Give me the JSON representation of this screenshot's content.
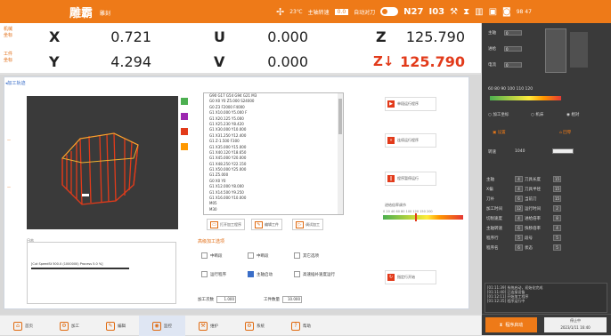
{
  "app": {
    "logo": "雕霸",
    "subtitle": "雕刻"
  },
  "topbar": {
    "temp": "23℃",
    "rpm_label": "主轴转速",
    "rpm_value": "0.0",
    "lock_label": "自动对刀",
    "counter1": "N27",
    "counter2": "I03",
    "status": "98 47"
  },
  "axes": {
    "mode_top": "机械\n坐标",
    "mode_bot": "工件\n坐标",
    "x": {
      "label": "X",
      "value": "0.721"
    },
    "y": {
      "label": "Y",
      "value": "4.294"
    },
    "u": {
      "label": "U",
      "value": "0.000"
    },
    "v": {
      "label": "V",
      "value": "0.000"
    },
    "z": {
      "label": "Z",
      "value": "125.790"
    },
    "z2": {
      "label": "Z",
      "value": "125.790"
    }
  },
  "main": {
    "tab": "◂加工轨迹",
    "program_lines": [
      "G90 G17 G54 G94 G21 M3",
      "G0 X0 Y0 Z5.000 S24000",
      "G0 Z3 F2000 F4000",
      "G1 X10.000 Y5.000 F",
      "G1 X20.125 Y5.000",
      "G1 X25.230 Y8.420",
      "G1 X30.000 Y10.000",
      "G1 X31.250 Y12.400",
      "G1 Z-1.500 F300",
      "G1 X35.000 Y15.000",
      "G1 X40.120 Y18.650",
      "G1 X45.000 Y20.000",
      "G1 X48.250 Y22.150",
      "G1 X50.000 Y25.000",
      "G1 Z5.000",
      "G0 X0 Y0",
      "G1 X12.000 Y8.000",
      "G1 X14.500 Y9.250",
      "G1 X16.000 Y10.000",
      "M05",
      "M30"
    ],
    "right_buttons": [
      "单段运行程序",
      "连续运行程序",
      "程序暂停运行"
    ],
    "bottom_buttons": [
      "打开加工程序",
      "编辑工件",
      "调试加工"
    ],
    "ratio_label": "进给倍率调节",
    "ratio_ticks": "0 20 40 60 80 100 120 150 200",
    "options_title": "高级加工选项",
    "opts_row1": [
      "中断段",
      "中断段",
      "其它选项"
    ],
    "opts_row2": [
      "运行程序",
      "主轴启动",
      "高速插补速度运行"
    ],
    "opt2_checked": true,
    "field1_label": "加工次数",
    "field1_value": "1.000",
    "field2_label": "工件数量",
    "field2_value": "10.000",
    "restart_btn": "指定行开始",
    "log_title": "日志",
    "log_line": "[Cut SpeedSt 500.0 (1000000) Process 5.0 %]"
  },
  "bottom_nav": [
    {
      "icon": "home-icon",
      "label": "首页"
    },
    {
      "icon": "process-icon",
      "label": "加工"
    },
    {
      "icon": "edit-icon",
      "label": "编辑"
    },
    {
      "icon": "monitor-icon",
      "label": "监控"
    },
    {
      "icon": "maintain-icon",
      "label": "维护"
    },
    {
      "icon": "settings-icon",
      "label": "系统"
    },
    {
      "icon": "help-icon",
      "label": "帮助"
    }
  ],
  "right_panel": {
    "rows_top": [
      {
        "label": "主轴",
        "value": "0"
      },
      {
        "label": "进给",
        "value": "0"
      },
      {
        "label": "电流",
        "value": "0"
      }
    ],
    "load_scale": "60  80  90 100 110 120",
    "radio_labels": [
      "加工坐标",
      "机床",
      "相对"
    ],
    "btn1": "设置",
    "btn2": "回零",
    "spindle_label": "转速",
    "spindle_value": "1040",
    "table": [
      {
        "a": "主轴",
        "b": "4",
        "c": "刀具长度",
        "d": "15"
      },
      {
        "a": "X偏",
        "b": "4",
        "c": "刀具半径",
        "d": "15"
      },
      {
        "a": "刀补",
        "b": "6",
        "c": "当前刀",
        "d": "15"
      },
      {
        "a": "加工时间",
        "b": "12",
        "c": "运行时间",
        "d": "2"
      },
      {
        "a": "切削速度",
        "b": "4",
        "c": "进给倍率",
        "d": "8"
      },
      {
        "a": "主轴转速",
        "b": "6",
        "c": "快移倍率",
        "d": "4"
      },
      {
        "a": "程序行",
        "b": "5",
        "c": "段号",
        "d": "5"
      },
      {
        "a": "程序名",
        "b": "6",
        "c": "状态",
        "d": "5"
      }
    ],
    "msg": "[01:11:39] 系统启动，初始化完成\n[01:11:40] 已连接设备\n[01:12:11] 开始加工程序\n[01:12:35] 程序运行中",
    "run_btn": "程序启动",
    "state_text": "停止中\n2023/1/11 16:40"
  },
  "colors": {
    "accent": "#ee7a18",
    "red": "#e23a1a",
    "dark": "#3a3a3a"
  }
}
